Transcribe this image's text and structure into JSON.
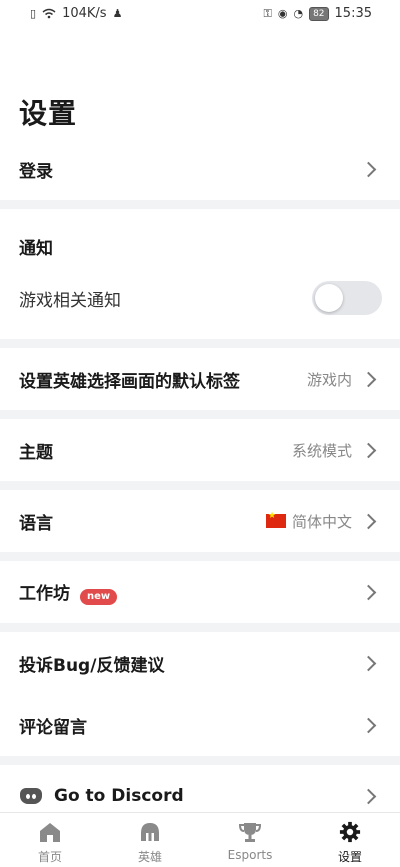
{
  "status_bar": {
    "network_speed": "104K/s",
    "battery": "82",
    "time": "15:35"
  },
  "page": {
    "title": "设置"
  },
  "rows": {
    "login": {
      "label": "登录"
    },
    "notifications_header": {
      "label": "通知"
    },
    "game_notifications": {
      "label": "游戏相关通知",
      "enabled": false
    },
    "default_tab": {
      "label": "设置英雄选择画面的默认标签",
      "value": "游戏内"
    },
    "theme": {
      "label": "主题",
      "value": "系统模式"
    },
    "language": {
      "label": "语言",
      "value": "简体中文"
    },
    "workshop": {
      "label": "工作坊",
      "badge": "new"
    },
    "report_bug": {
      "label": "投诉Bug/反馈建议"
    },
    "review": {
      "label": "评论留言"
    },
    "discord": {
      "label": "Go to Discord"
    }
  },
  "tabs": [
    {
      "label": "首页",
      "icon": "home-icon",
      "active": false
    },
    {
      "label": "英雄",
      "icon": "helmet-icon",
      "active": false
    },
    {
      "label": "Esports",
      "icon": "trophy-icon",
      "active": false
    },
    {
      "label": "设置",
      "icon": "gear-icon",
      "active": true
    }
  ]
}
